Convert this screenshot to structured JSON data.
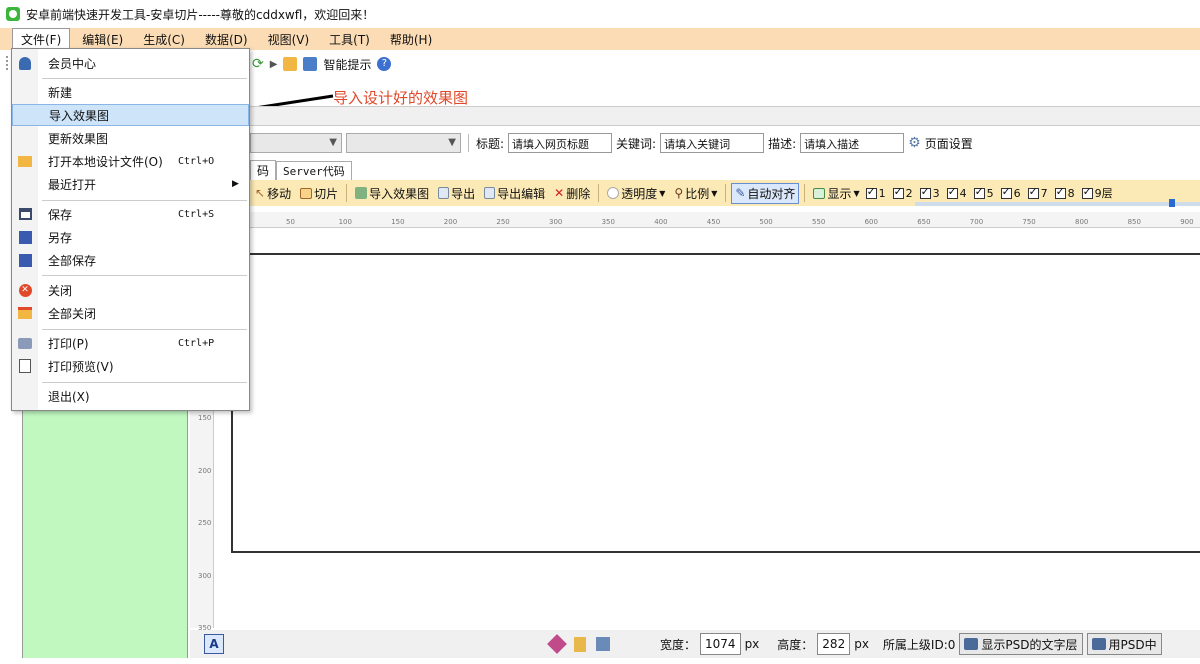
{
  "window": {
    "title": "安卓前端快速开发工具-安卓切片-----尊敬的cddxwfl，欢迎回来！"
  },
  "menubar": {
    "items": [
      "文件(F)",
      "编辑(E)",
      "生成(C)",
      "数据(D)",
      "视图(V)",
      "工具(T)",
      "帮助(H)"
    ]
  },
  "toolbar1": {
    "smart_hint": "智能提示"
  },
  "annotation": {
    "text": "导入设计好的效果图"
  },
  "dropdown": {
    "member_center": "会员中心",
    "new": "新建",
    "import_effect": "导入效果图",
    "update_effect": "更新效果图",
    "open_local": "打开本地设计文件(O)",
    "open_local_shortcut": "Ctrl+O",
    "recent": "最近打开",
    "save": "保存",
    "save_shortcut": "Ctrl+S",
    "save_as": "另存",
    "save_all": "全部保存",
    "close": "关闭",
    "close_all": "全部关闭",
    "print": "打印(P)",
    "print_shortcut": "Ctrl+P",
    "print_preview": "打印预览(V)",
    "exit": "退出(X)"
  },
  "propbar": {
    "title_label": "标题:",
    "title_placeholder": "请填入网页标题",
    "keyword_label": "关键词:",
    "keyword_placeholder": "请填入关键词",
    "desc_label": "描述:",
    "desc_placeholder": "请填入描述",
    "page_settings": "页面设置"
  },
  "tabs": {
    "partial": "码",
    "server": "Server代码"
  },
  "toolbar2": {
    "move": "移动",
    "slice": "切片",
    "import": "导入效果图",
    "export": "导出",
    "export_edit": "导出编辑",
    "delete": "删除",
    "opacity": "透明度",
    "scale": "比例",
    "auto_align": "自动对齐",
    "display": "显示",
    "layers": [
      "1",
      "2",
      "3",
      "4",
      "5",
      "6",
      "7",
      "8",
      "9层"
    ]
  },
  "ruler": {
    "top_ticks": [
      "50",
      "100",
      "150",
      "200",
      "250",
      "300",
      "350",
      "400",
      "450",
      "500",
      "550",
      "600",
      "650",
      "700",
      "750",
      "800",
      "850",
      "900"
    ],
    "left_ticks": [
      "150",
      "200",
      "250",
      "300",
      "350"
    ]
  },
  "statusbar": {
    "width_label": "宽度：",
    "width_value": "1074",
    "width_unit": "px",
    "height_label": "高度：",
    "height_value": "282",
    "height_unit": "px",
    "parent_id": "所属上级ID:0",
    "show_psd_text": "显示PSD的文字层",
    "use_psd": "用PSD中"
  },
  "colors": {
    "menubar": "#fbdcb5",
    "toolbar2": "#fbe9b6",
    "left_panel": "#c0f8c0",
    "highlight": "#cde4f9",
    "annotation": "#e0482a"
  }
}
